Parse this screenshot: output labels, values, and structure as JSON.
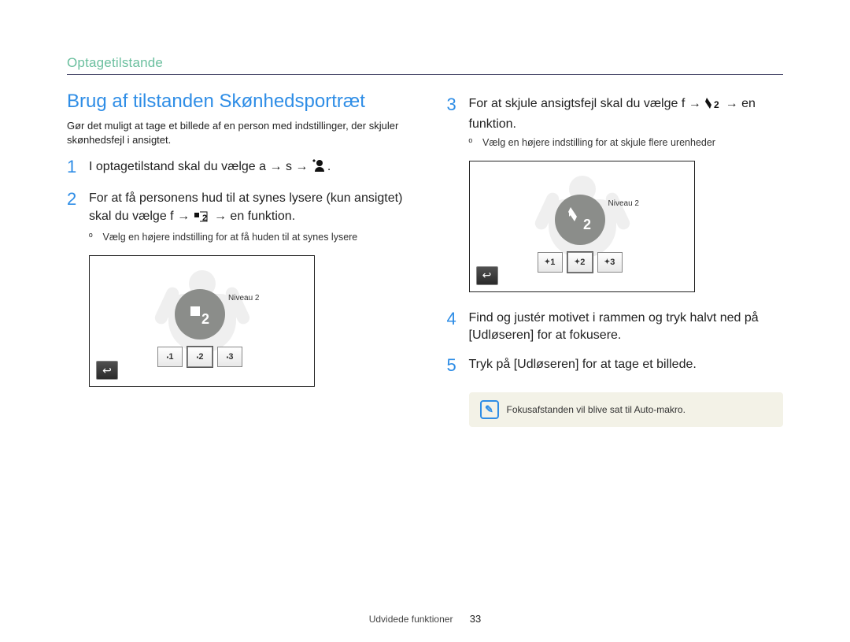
{
  "header": {
    "section": "Optagetilstande"
  },
  "left": {
    "title": "Brug af tilstanden Skønhedsportræt",
    "lead": "Gør det muligt at tage et billede af en person med indstillinger, der skjuler skønhedsfejl i ansigtet.",
    "steps": {
      "s1": {
        "num": "1",
        "pre": "I optagetilstand skal du vælge  a",
        "mid": "s"
      },
      "s2": {
        "num": "2",
        "text": "For at få personens hud til at synes lysere (kun ansigtet) skal du vælge  f",
        "tail": "en funktion."
      }
    },
    "note": "Vælg en højere indstilling for at få huden til at synes lysere",
    "shot": {
      "disc_label": "Niveau 2",
      "icons": [
        "1",
        "2",
        "3"
      ]
    }
  },
  "right": {
    "steps": {
      "s3": {
        "num": "3",
        "text": "For at skjule ansigtsfejl skal du vælge f",
        "tail": "en funktion."
      },
      "s4": {
        "num": "4",
        "text": "Find og justér motivet i rammen og tryk halvt ned på [Udløseren] for at fokusere."
      },
      "s5": {
        "num": "5",
        "text": "Tryk på [Udløseren] for at tage et billede."
      }
    },
    "note": "Vælg en højere indstilling for at skjule flere urenheder",
    "shot": {
      "disc_label": "Niveau 2",
      "icons": [
        "1",
        "2",
        "3"
      ]
    },
    "tip": "Fokusafstanden vil blive sat til Auto-makro."
  },
  "footer": {
    "label": "Udvidede funktioner",
    "page": "33"
  },
  "glyphs": {
    "arrow": "→",
    "bullet": "º"
  }
}
